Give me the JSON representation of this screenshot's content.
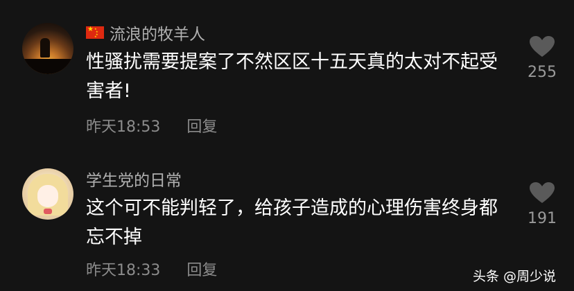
{
  "comments": [
    {
      "username": "流浪的牧羊人",
      "has_flag": true,
      "text": "性骚扰需要提案了不然区区十五天真的太对不起受害者!",
      "time": "昨天18:53",
      "reply_label": "回复",
      "likes": "255",
      "like_icon": "heart-icon"
    },
    {
      "username": "学生党的日常",
      "has_flag": false,
      "text": "这个可不能判轻了，给孩子造成的心理伤害终身都忘不掉",
      "time": "昨天18:33",
      "reply_label": "回复",
      "likes": "191",
      "like_icon": "heart-icon"
    }
  ],
  "watermark": "头条 @周少说",
  "colors": {
    "background": "#141414",
    "username": "#b0b0b0",
    "text": "#ffffff",
    "meta": "#8c8c8c",
    "heart": "#5a5a5a"
  }
}
